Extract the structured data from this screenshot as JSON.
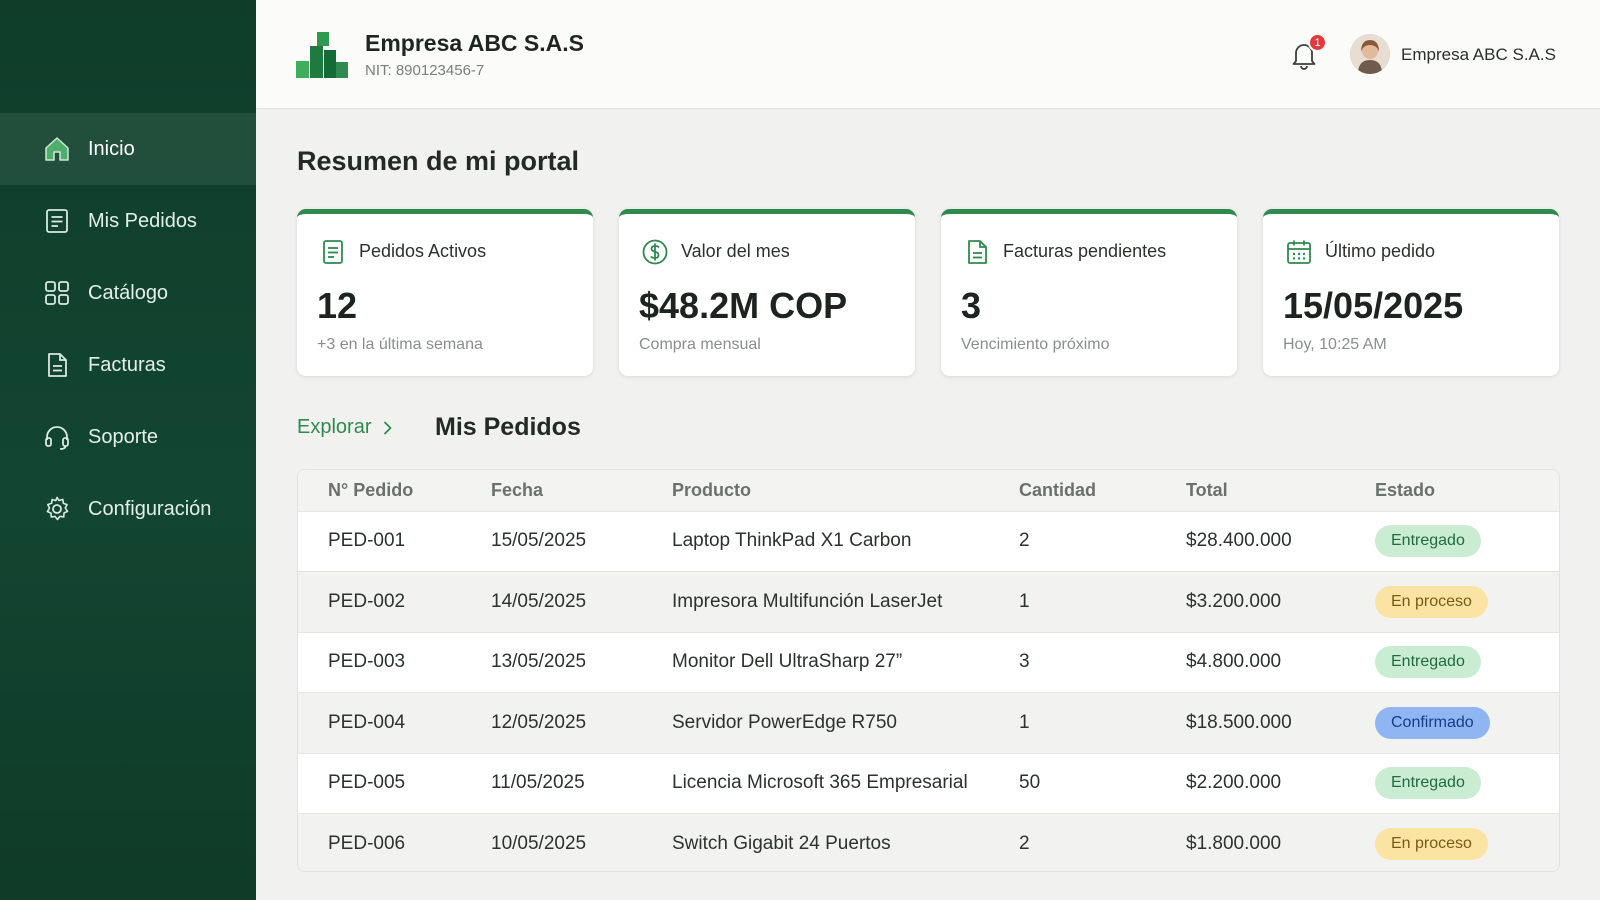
{
  "header": {
    "company_name": "Empresa ABC S.A.S",
    "company_nit": "NIT: 890123456-7",
    "notification_count": "1",
    "user_name": "Empresa ABC S.A.S"
  },
  "sidebar": {
    "items": [
      {
        "label": "Inicio",
        "icon": "home-icon",
        "active": true
      },
      {
        "label": "Mis Pedidos",
        "icon": "document-list-icon"
      },
      {
        "label": "Catálogo",
        "icon": "grid-icon"
      },
      {
        "label": "Facturas",
        "icon": "invoice-icon"
      },
      {
        "label": "Soporte",
        "icon": "headset-icon"
      },
      {
        "label": "Configuración",
        "icon": "gear-icon"
      }
    ]
  },
  "main": {
    "title": "Resumen de mi portal",
    "cards": [
      {
        "label": "Pedidos Activos",
        "value": "12",
        "sub": "+3 en la última semana",
        "icon": "document-icon"
      },
      {
        "label": "Valor del mes",
        "value": "$48.2M COP",
        "sub": "Compra mensual",
        "icon": "dollar-circle-icon"
      },
      {
        "label": "Facturas pendientes",
        "value": "3",
        "sub": "Vencimiento próximo",
        "icon": "invoice-icon"
      },
      {
        "label": "Último pedido",
        "value": "15/05/2025",
        "sub": "Hoy, 10:25 AM",
        "icon": "calendar-icon"
      }
    ],
    "breadcrumb_link": "Explorar",
    "section_title": "Mis Pedidos",
    "table": {
      "columns": [
        "N° Pedido",
        "Fecha",
        "Producto",
        "Cantidad",
        "Total",
        "Estado"
      ],
      "rows": [
        [
          "PED-001",
          "15/05/2025",
          "Laptop ThinkPad X1 Carbon",
          "2",
          "$28.400.000",
          "Entregado"
        ],
        [
          "PED-002",
          "14/05/2025",
          "Impresora Multifunción LaserJet",
          "1",
          "$3.200.000",
          "En proceso"
        ],
        [
          "PED-003",
          "13/05/2025",
          "Monitor Dell UltraSharp 27”",
          "3",
          "$4.800.000",
          "Entregado"
        ],
        [
          "PED-004",
          "12/05/2025",
          "Servidor PowerEdge R750",
          "1",
          "$18.500.000",
          "Confirmado"
        ],
        [
          "PED-005",
          "11/05/2025",
          "Licencia Microsoft 365 Empresarial",
          "50",
          "$2.200.000",
          "Entregado"
        ],
        [
          "PED-006",
          "10/05/2025",
          "Switch Gigabit 24 Puertos",
          "2",
          "$1.800.000",
          "En proceso"
        ]
      ]
    }
  },
  "colors": {
    "sidebar_bg": "#124632",
    "accent": "#2e8a4e",
    "status_entregado": "#c9ecd3",
    "status_en_proceso": "#fbe3a3",
    "status_confirmado": "#8fb6f2",
    "notification": "#e43a3a"
  }
}
